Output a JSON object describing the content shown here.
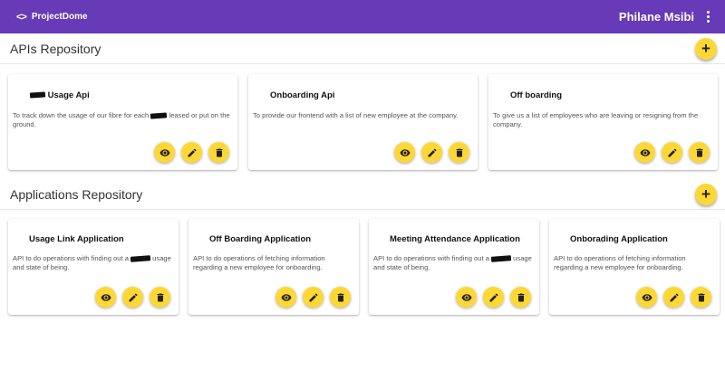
{
  "appbar": {
    "brand_icon": "<>",
    "brand": "ProjectDome",
    "user": "Philane Msibi"
  },
  "colors": {
    "appbar": "#673ab7",
    "accent": "#fdd835"
  },
  "apis": {
    "title": "APIs Repository",
    "cards": [
      {
        "title": "Usage Api",
        "desc_before": "To track down the usage of our fibre for each",
        "desc_after": "leased or put on the ground."
      },
      {
        "title": "Onboarding Api",
        "desc": "To provide our frontend with a list of new employee at the company."
      },
      {
        "title": "Off boarding",
        "desc": "To give us a list of employees who are leaving or resigning from the company."
      }
    ]
  },
  "apps": {
    "title": "Applications Repository",
    "cards": [
      {
        "title": "Usage Link Application",
        "desc_before": "API to do operations with finding out a",
        "desc_after": "usage and state of being."
      },
      {
        "title": "Off Boarding Application",
        "desc": "API to do operations of fetching information regarding a new employee for onboarding."
      },
      {
        "title": "Meeting Attendance Application",
        "desc_before": "API to do operations with finding out a",
        "desc_after": "usage and state of being."
      },
      {
        "title": "Onborading Application",
        "desc": "API to do operations of fetching information regarding a new employee for onboarding."
      }
    ]
  },
  "icons": {
    "add": "+",
    "view": "eye-icon",
    "edit": "pencil-icon",
    "delete": "trash-icon",
    "menu": "more-vert-icon"
  }
}
